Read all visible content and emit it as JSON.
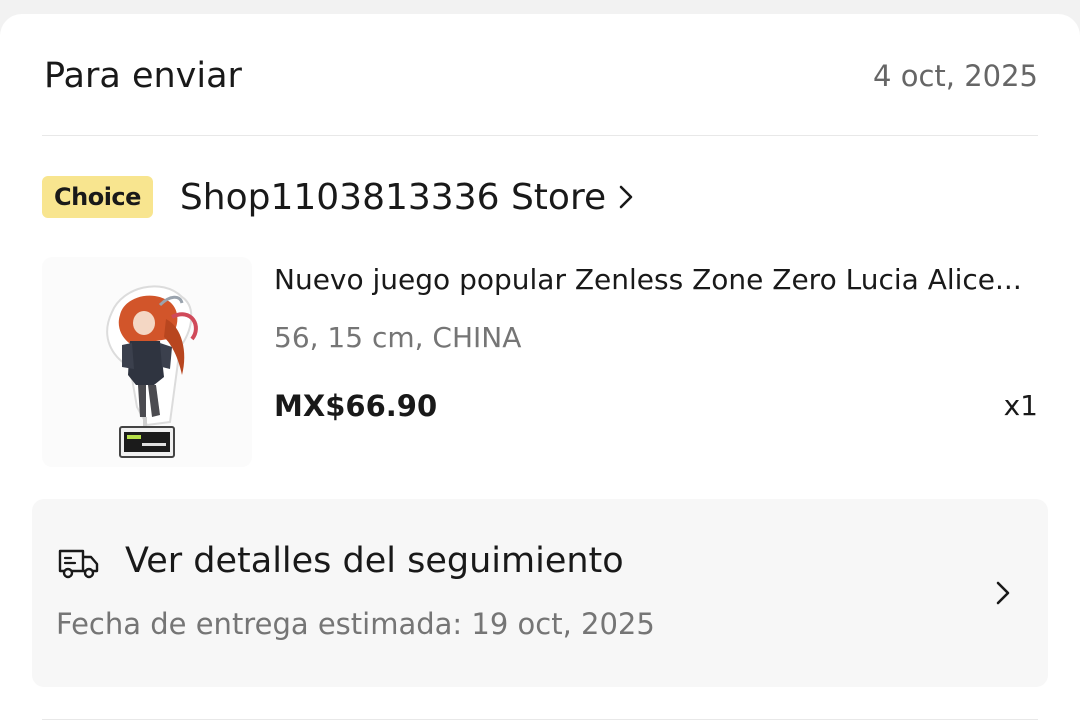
{
  "order": {
    "status_title": "Para enviar",
    "date": "4 oct, 2025"
  },
  "store": {
    "badge": "Choice",
    "name": "Shop1103813336 Store",
    "badge_color": "#f8e58f"
  },
  "product": {
    "title": "Nuevo juego popular Zenless Zone Zero Lucia Alice...",
    "variant": "56, 15 cm, CHINA",
    "price": "MX$66.90",
    "quantity": "x1",
    "image_icon": "acrylic-stand-figure"
  },
  "tracking": {
    "icon": "truck-icon",
    "title": "Ver detalles del seguimiento",
    "estimate": "Fecha de entrega estimada: 19 oct, 2025"
  }
}
